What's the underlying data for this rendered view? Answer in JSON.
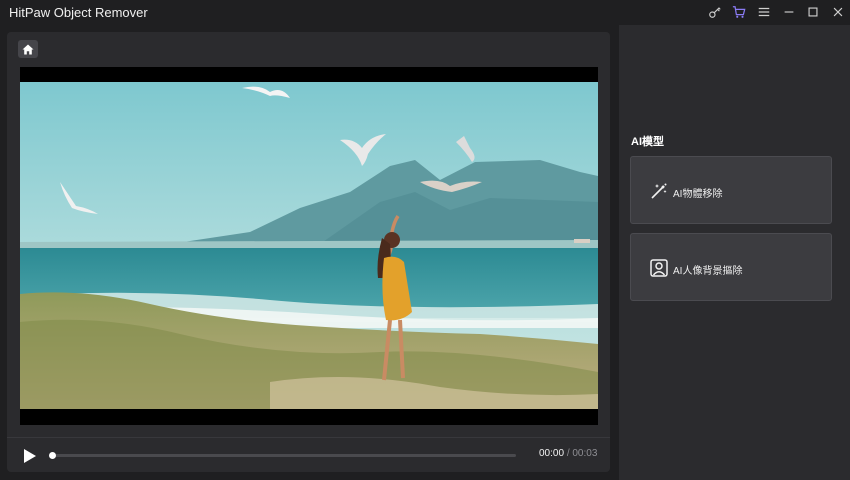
{
  "app": {
    "title": "HitPaw Object Remover"
  },
  "titlebar": {
    "icons": [
      "key-icon",
      "cart-icon",
      "menu-icon",
      "minimize-icon",
      "maximize-icon",
      "close-icon"
    ],
    "accent_color": "#8b7cf6"
  },
  "player": {
    "current_time": "00:00",
    "separator": "/",
    "duration": "00:03",
    "progress": 0.0
  },
  "side_panel": {
    "title": "AI模型",
    "cards": [
      {
        "label": "AI物體移除",
        "icon": "magic-wand-icon"
      },
      {
        "label": "AI人像背景摳除",
        "icon": "portrait-icon"
      }
    ]
  }
}
